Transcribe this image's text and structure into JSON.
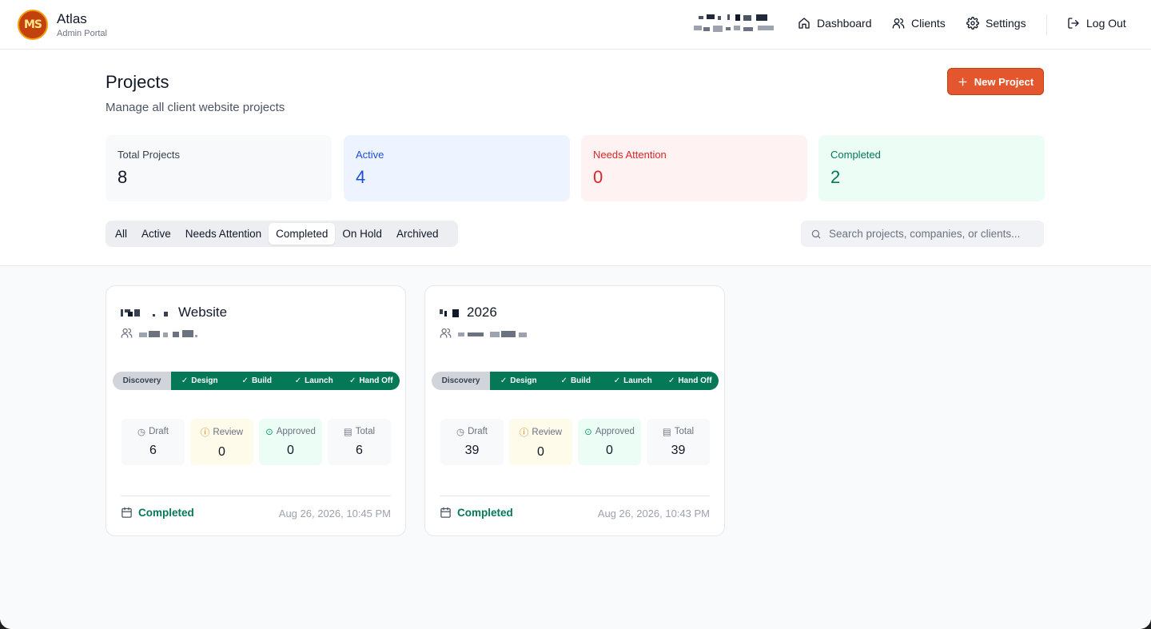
{
  "app": {
    "name": "Atlas",
    "subtitle": "Admin Portal",
    "logo_text": "MS"
  },
  "nav": {
    "dashboard": "Dashboard",
    "clients": "Clients",
    "settings": "Settings",
    "logout": "Log Out"
  },
  "page": {
    "title": "Projects",
    "subtitle": "Manage all client website projects",
    "new_button": "New Project"
  },
  "stats": [
    {
      "label": "Total Projects",
      "value": "8"
    },
    {
      "label": "Active",
      "value": "4"
    },
    {
      "label": "Needs Attention",
      "value": "0"
    },
    {
      "label": "Completed",
      "value": "2"
    }
  ],
  "tabs": [
    "All",
    "Active",
    "Needs Attention",
    "Completed",
    "On Hold",
    "Archived"
  ],
  "active_tab": "Completed",
  "search": {
    "placeholder": "Search projects, companies, or clients..."
  },
  "stages": [
    "Discovery",
    "Design",
    "Build",
    "Launch",
    "Hand Off"
  ],
  "metric_labels": {
    "draft": "Draft",
    "review": "Review",
    "approved": "Approved",
    "total": "Total"
  },
  "cards": [
    {
      "title": "Website",
      "metrics": {
        "draft": "6",
        "review": "0",
        "approved": "0",
        "total": "6"
      },
      "status": "Completed",
      "date": "Aug 26, 2026, 10:45 PM"
    },
    {
      "title": "2026",
      "metrics": {
        "draft": "39",
        "review": "0",
        "approved": "0",
        "total": "39"
      },
      "status": "Completed",
      "date": "Aug 26, 2026, 10:43 PM"
    }
  ],
  "colors": {
    "accent": "#e4572e",
    "active_blue": "#1d4ed8",
    "attention_red": "#dc2626",
    "completed_green": "#047857"
  }
}
